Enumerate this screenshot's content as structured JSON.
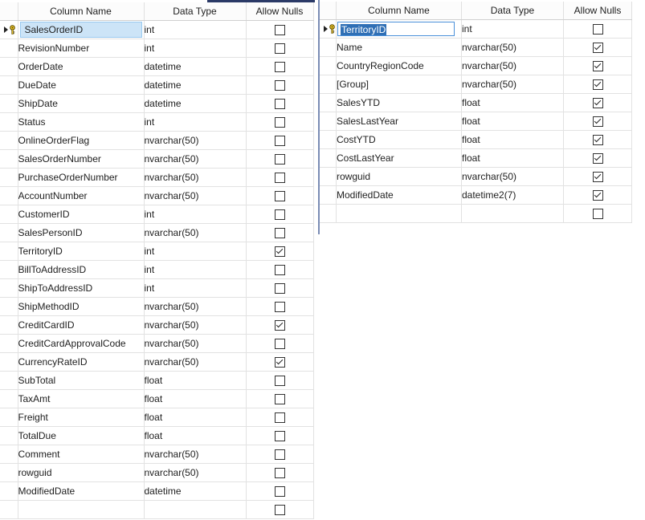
{
  "headers": {
    "column_name": "Column Name",
    "data_type": "Data Type",
    "allow_nulls": "Allow Nulls"
  },
  "left_table": {
    "rows": [
      {
        "name": "SalesOrderID",
        "type": "int",
        "allow_nulls": false,
        "primary_key": true
      },
      {
        "name": "RevisionNumber",
        "type": "int",
        "allow_nulls": false
      },
      {
        "name": "OrderDate",
        "type": "datetime",
        "allow_nulls": false
      },
      {
        "name": "DueDate",
        "type": "datetime",
        "allow_nulls": false
      },
      {
        "name": "ShipDate",
        "type": "datetime",
        "allow_nulls": false
      },
      {
        "name": "Status",
        "type": "int",
        "allow_nulls": false
      },
      {
        "name": "OnlineOrderFlag",
        "type": "nvarchar(50)",
        "allow_nulls": false
      },
      {
        "name": "SalesOrderNumber",
        "type": "nvarchar(50)",
        "allow_nulls": false
      },
      {
        "name": "PurchaseOrderNumber",
        "type": "nvarchar(50)",
        "allow_nulls": false
      },
      {
        "name": "AccountNumber",
        "type": "nvarchar(50)",
        "allow_nulls": false
      },
      {
        "name": "CustomerID",
        "type": "int",
        "allow_nulls": false
      },
      {
        "name": "SalesPersonID",
        "type": "nvarchar(50)",
        "allow_nulls": false
      },
      {
        "name": "TerritoryID",
        "type": "int",
        "allow_nulls": true
      },
      {
        "name": "BillToAddressID",
        "type": "int",
        "allow_nulls": false
      },
      {
        "name": "ShipToAddressID",
        "type": "int",
        "allow_nulls": false
      },
      {
        "name": "ShipMethodID",
        "type": "nvarchar(50)",
        "allow_nulls": false
      },
      {
        "name": "CreditCardID",
        "type": "nvarchar(50)",
        "allow_nulls": true
      },
      {
        "name": "CreditCardApprovalCode",
        "type": "nvarchar(50)",
        "allow_nulls": false
      },
      {
        "name": "CurrencyRateID",
        "type": "nvarchar(50)",
        "allow_nulls": true
      },
      {
        "name": "SubTotal",
        "type": "float",
        "allow_nulls": false
      },
      {
        "name": "TaxAmt",
        "type": "float",
        "allow_nulls": false
      },
      {
        "name": "Freight",
        "type": "float",
        "allow_nulls": false
      },
      {
        "name": "TotalDue",
        "type": "float",
        "allow_nulls": false
      },
      {
        "name": "Comment",
        "type": "nvarchar(50)",
        "allow_nulls": false
      },
      {
        "name": "rowguid",
        "type": "nvarchar(50)",
        "allow_nulls": false
      },
      {
        "name": "ModifiedDate",
        "type": "datetime",
        "allow_nulls": false
      },
      {
        "name": "",
        "type": "",
        "allow_nulls": false
      }
    ]
  },
  "right_table": {
    "rows": [
      {
        "name": "TerritoryID",
        "type": "int",
        "allow_nulls": false,
        "primary_key": true,
        "editing": true
      },
      {
        "name": "Name",
        "type": "nvarchar(50)",
        "allow_nulls": true
      },
      {
        "name": "CountryRegionCode",
        "type": "nvarchar(50)",
        "allow_nulls": true
      },
      {
        "name": "[Group]",
        "type": "nvarchar(50)",
        "allow_nulls": true
      },
      {
        "name": "SalesYTD",
        "type": "float",
        "allow_nulls": true
      },
      {
        "name": "SalesLastYear",
        "type": "float",
        "allow_nulls": true
      },
      {
        "name": "CostYTD",
        "type": "float",
        "allow_nulls": true
      },
      {
        "name": "CostLastYear",
        "type": "float",
        "allow_nulls": true
      },
      {
        "name": "rowguid",
        "type": "nvarchar(50)",
        "allow_nulls": true
      },
      {
        "name": "ModifiedDate",
        "type": "datetime2(7)",
        "allow_nulls": true
      },
      {
        "name": "",
        "type": "",
        "allow_nulls": false
      }
    ]
  },
  "icons": {
    "row_selector": "row-selector-arrow-icon",
    "primary_key": "primary-key-icon",
    "checkbox": "checkbox-icon"
  },
  "colors": {
    "selection": "#cce4f7",
    "edit_highlight": "#2f6fb5",
    "title_strip": "#2b3a67"
  }
}
